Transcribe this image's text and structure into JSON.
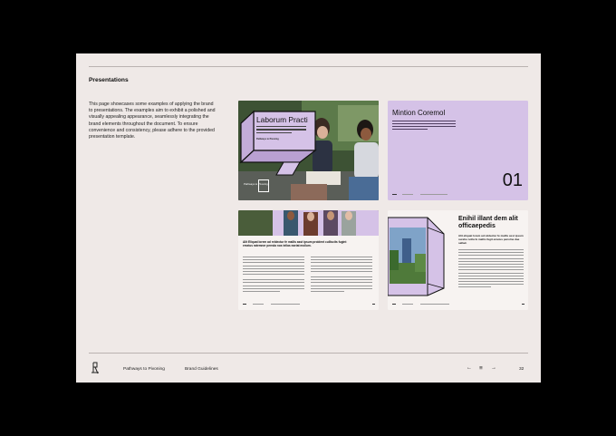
{
  "section_title": "Presentations",
  "description": "This page showcases some examples of applying the brand to presentations. The examples aim to exhibit a polished and visually appealing appearance, seamlessly integrating the brand elements throughout the document. To ensure convenience and consistency, please adhere to the provided presentation template.",
  "colors": {
    "accent": "#d5c2e7",
    "border": "#1b1b1b",
    "page": "#efe9e7"
  },
  "slides": [
    {
      "title": "Laborum Practi",
      "label": "Pathways to Pivoning"
    },
    {
      "title": "Mintion Coremol",
      "number": "01"
    },
    {
      "heading": "Alit Eliquat lorem ad reldectur fe mallis asst ipsum proident culliscits fugint emeius ratemner pernda nos tellas eaeiat mollum."
    },
    {
      "title": "Enihil illant dem alit officaepedis",
      "subtitle": "Alit eliquat lorem ad reldectur fe mallis asst ipsum surehe nolla fe mallis fugit emeius penolne dae sallad."
    }
  ],
  "footer": {
    "brand": "Pathways to Pivoning",
    "doc": "Brand Guidelines",
    "prev_icon": "arrow-left-icon",
    "menu_icon": "menu-icon",
    "next_icon": "arrow-right-icon",
    "page_number": "32"
  }
}
